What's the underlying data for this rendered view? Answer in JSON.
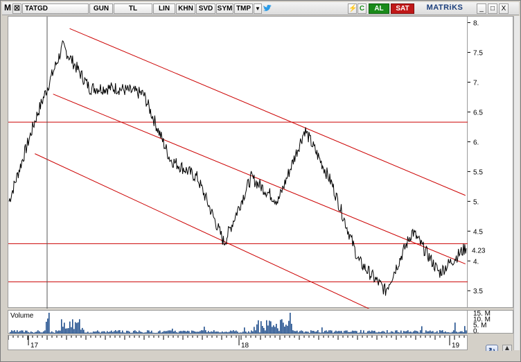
{
  "toolbar": {
    "menu_label": "M",
    "checkbox_mark": "☒",
    "symbol": "TATGD",
    "period": "GUN",
    "currency": "TL",
    "scale": "LIN",
    "khn": "KHN",
    "svd": "SVD",
    "sym": "SYM",
    "tmp": "TMP",
    "dropdown_arrow": "▼",
    "bird": "🐦",
    "flash": "⚡",
    "c_label": "C",
    "buy_label": "AL",
    "sell_label": "SAT",
    "brand": "MATRiKS",
    "win_min": "_",
    "win_max": "□",
    "win_close": "X"
  },
  "price_axis": {
    "ticks": [
      "8.",
      "7.5",
      "7.",
      "6.5",
      "6.",
      "5.5",
      "5.",
      "4.5",
      "4.",
      "3.5"
    ],
    "current_price": "4.23"
  },
  "volume": {
    "title": "Volume",
    "ticks": [
      "15. M",
      "10. M",
      "5. M",
      "0."
    ]
  },
  "time_axis": {
    "labels": [
      "17",
      "18",
      "19"
    ]
  },
  "colors": {
    "price_line": "#000000",
    "channel_lines": "#cc0000",
    "volume_bars": "#1f4e8c",
    "buy": "#1a8a1a",
    "sell": "#c01818"
  },
  "chart_data": {
    "type": "line",
    "title": "",
    "symbol": "TATGD",
    "ylim": [
      3.2,
      8.1
    ],
    "log_scale": false,
    "x": [
      "2016-12",
      "2017-01",
      "2017-03",
      "2017-05",
      "2017-07",
      "2017-09",
      "2017-10",
      "2017-12",
      "2018-02",
      "2018-04",
      "2018-06",
      "2018-07",
      "2018-09",
      "2018-11",
      "2018-12",
      "2019-01"
    ],
    "series": [
      {
        "name": "",
        "values": [
          5.0,
          6.4,
          7.6,
          6.9,
          6.9,
          6.8,
          5.7,
          5.4,
          4.3,
          5.4,
          5.0,
          6.2,
          5.3,
          4.0,
          3.5,
          4.5,
          3.8,
          4.23
        ]
      }
    ],
    "horizontal_lines": [
      6.33,
      4.29,
      3.65
    ],
    "channel_lines": [
      {
        "from": [
          "2017-03",
          7.9
        ],
        "to": [
          "2019-01",
          5.1
        ]
      },
      {
        "from": [
          "2017-02",
          6.8
        ],
        "to": [
          "2019-01",
          3.95
        ]
      },
      {
        "from": [
          "2017-01",
          5.8
        ],
        "to": [
          "2018-08",
          3.15
        ]
      }
    ],
    "grid": false
  }
}
